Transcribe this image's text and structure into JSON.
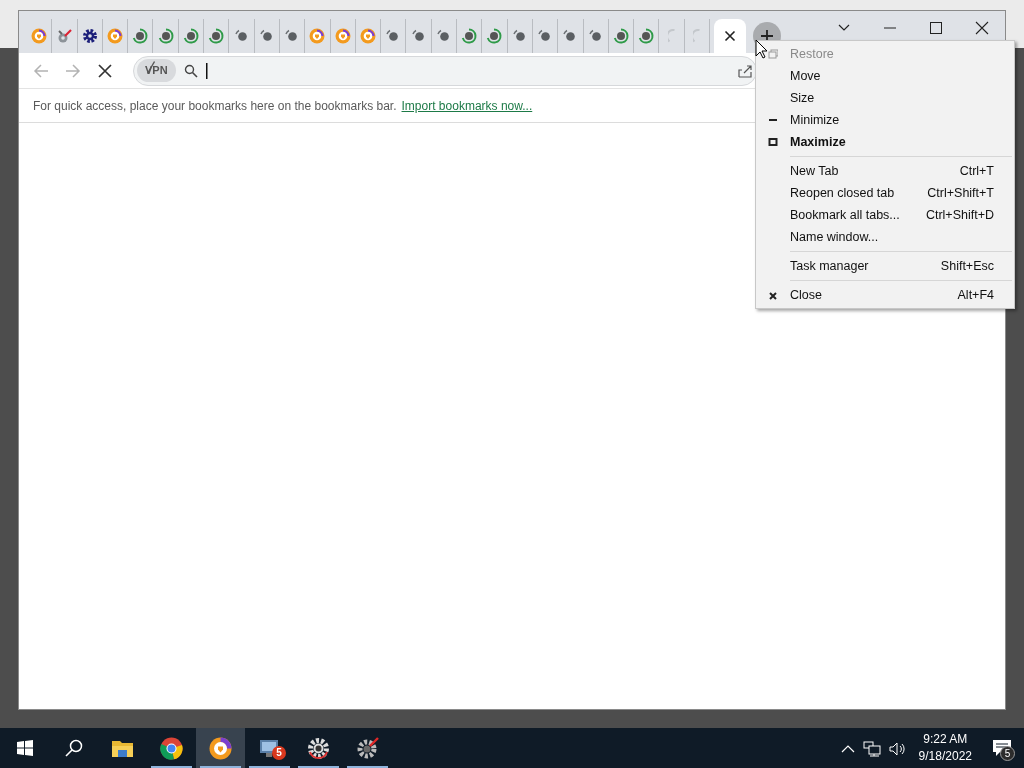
{
  "browser": {
    "tabs": [
      {
        "kind": "shield",
        "selected": false
      },
      {
        "kind": "tool",
        "selected": false
      },
      {
        "kind": "gear",
        "selected": false
      },
      {
        "kind": "shield",
        "selected": false
      },
      {
        "kind": "spinner",
        "selected": false
      },
      {
        "kind": "spinner",
        "selected": false
      },
      {
        "kind": "spinner",
        "selected": false
      },
      {
        "kind": "spinner",
        "selected": false
      },
      {
        "kind": "dot",
        "selected": false
      },
      {
        "kind": "dot",
        "selected": false
      },
      {
        "kind": "dot",
        "selected": false
      },
      {
        "kind": "shield",
        "selected": false
      },
      {
        "kind": "shield",
        "selected": false
      },
      {
        "kind": "shield",
        "selected": false
      },
      {
        "kind": "dot",
        "selected": false
      },
      {
        "kind": "dot",
        "selected": false
      },
      {
        "kind": "dot",
        "selected": false
      },
      {
        "kind": "spinner",
        "selected": false
      },
      {
        "kind": "spinner",
        "selected": false
      },
      {
        "kind": "dot",
        "selected": false
      },
      {
        "kind": "dot",
        "selected": false
      },
      {
        "kind": "dot",
        "selected": false
      },
      {
        "kind": "dot",
        "selected": false
      },
      {
        "kind": "spinner",
        "selected": false
      },
      {
        "kind": "spinner",
        "selected": false
      },
      {
        "kind": "faded",
        "selected": false
      },
      {
        "kind": "faded",
        "selected": false
      },
      {
        "kind": "blank",
        "selected": true
      }
    ],
    "toolbar": {
      "back_disabled": true,
      "forward_disabled": true,
      "vpn": {
        "label": "VPN",
        "enabled": false
      }
    },
    "bookmarks_bar": {
      "message": "For quick access, place your bookmarks here on the bookmarks bar.",
      "link": "Import bookmarks now..."
    }
  },
  "system_menu": {
    "items": [
      {
        "kind": "item",
        "label": "Restore",
        "disabled": true,
        "default": false
      },
      {
        "kind": "item",
        "label": "Move",
        "disabled": false,
        "default": false
      },
      {
        "kind": "item",
        "label": "Size",
        "disabled": false,
        "default": false
      },
      {
        "kind": "item",
        "label": "Minimize",
        "disabled": false,
        "default": false
      },
      {
        "kind": "item",
        "label": "Maximize",
        "disabled": false,
        "default": true
      },
      {
        "kind": "separator"
      },
      {
        "kind": "item",
        "label": "New Tab",
        "shortcut": "Ctrl+T",
        "disabled": false,
        "default": false
      },
      {
        "kind": "item",
        "label": "Reopen closed tab",
        "shortcut": "Ctrl+Shift+T",
        "disabled": false,
        "default": false
      },
      {
        "kind": "item",
        "label": "Bookmark all tabs...",
        "shortcut": "Ctrl+Shift+D",
        "disabled": false,
        "default": false
      },
      {
        "kind": "item",
        "label": "Name window...",
        "disabled": false,
        "default": false
      },
      {
        "kind": "separator"
      },
      {
        "kind": "item",
        "label": "Task manager",
        "shortcut": "Shift+Esc",
        "disabled": false,
        "default": false
      },
      {
        "kind": "separator"
      },
      {
        "kind": "item",
        "label": "Close",
        "shortcut": "Alt+F4",
        "disabled": false,
        "default": false
      }
    ]
  },
  "taskbar": {
    "apps": [
      {
        "kind": "folder",
        "running": false,
        "selected": false
      },
      {
        "kind": "ring",
        "running": true,
        "selected": false
      },
      {
        "kind": "shield",
        "running": true,
        "selected": true
      },
      {
        "kind": "monitor",
        "running": true,
        "selected": false,
        "badge": "5"
      },
      {
        "kind": "gear-circle",
        "running": true,
        "selected": false
      },
      {
        "kind": "gear-red",
        "running": true,
        "selected": false
      }
    ],
    "tray": {
      "time": "9:22 AM",
      "date": "9/18/2022",
      "notifications": "5"
    }
  }
}
